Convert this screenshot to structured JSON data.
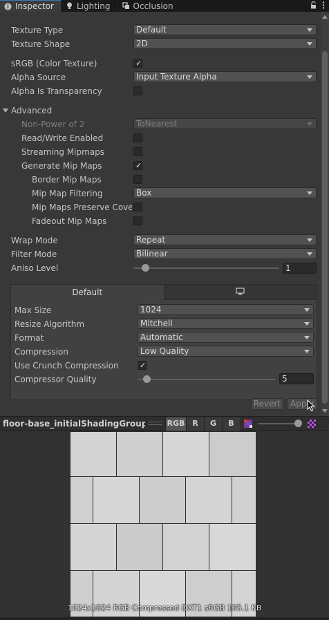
{
  "tabs": [
    {
      "label": "Inspector",
      "icon": "info-icon",
      "active": true
    },
    {
      "label": "Lighting",
      "icon": "lightbulb-icon",
      "active": false
    },
    {
      "label": "Occlusion",
      "icon": "occlusion-icon",
      "active": false
    }
  ],
  "settings": {
    "texture_type": {
      "label": "Texture Type",
      "value": "Default"
    },
    "texture_shape": {
      "label": "Texture Shape",
      "value": "2D"
    },
    "srgb": {
      "label": "sRGB (Color Texture)",
      "checked": true
    },
    "alpha_source": {
      "label": "Alpha Source",
      "value": "Input Texture Alpha"
    },
    "alpha_transparency": {
      "label": "Alpha Is Transparency",
      "checked": false
    },
    "advanced": {
      "label": "Advanced",
      "expanded": true
    },
    "non_power": {
      "label": "Non-Power of 2",
      "value": "ToNearest"
    },
    "read_write": {
      "label": "Read/Write Enabled",
      "checked": false
    },
    "streaming_mipmaps": {
      "label": "Streaming Mipmaps",
      "checked": false
    },
    "generate_mipmaps": {
      "label": "Generate Mip Maps",
      "checked": true
    },
    "border_mipmaps": {
      "label": "Border Mip Maps",
      "checked": false
    },
    "mipmap_filtering": {
      "label": "Mip Map Filtering",
      "value": "Box"
    },
    "mipmaps_preserve": {
      "label": "Mip Maps Preserve Coverage",
      "checked": false
    },
    "fadeout_mipmaps": {
      "label": "Fadeout Mip Maps",
      "checked": false
    },
    "wrap_mode": {
      "label": "Wrap Mode",
      "value": "Repeat"
    },
    "filter_mode": {
      "label": "Filter Mode",
      "value": "Bilinear"
    },
    "aniso_level": {
      "label": "Aniso Level",
      "value": "1"
    }
  },
  "platform": {
    "default_tab": "Default",
    "pc_tab_icon": "monitor-icon",
    "max_size": {
      "label": "Max Size",
      "value": "1024"
    },
    "resize_algorithm": {
      "label": "Resize Algorithm",
      "value": "Mitchell"
    },
    "format": {
      "label": "Format",
      "value": "Automatic"
    },
    "compression": {
      "label": "Compression",
      "value": "Low Quality"
    },
    "use_crunch": {
      "label": "Use Crunch Compression",
      "checked": true
    },
    "compressor_quality": {
      "label": "Compressor Quality",
      "value": "5"
    }
  },
  "buttons": {
    "revert": "Revert",
    "apply": "Apply"
  },
  "preview": {
    "title": "floor-base_initialShadingGroup_Albedo",
    "channels": [
      "RGB",
      "R",
      "G",
      "B"
    ],
    "info": "1024x1024  RGB Compressed DXT1 sRGB  105.1 KB"
  },
  "colors": {
    "accent": "#3a79bb",
    "panel": "#383838"
  }
}
